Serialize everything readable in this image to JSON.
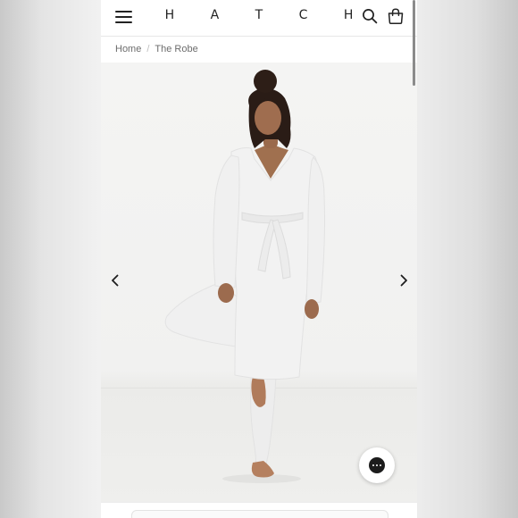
{
  "header": {
    "menu_icon": "hamburger-menu-icon",
    "logo": "H A T C H",
    "search_icon": "search-icon",
    "bag_icon": "shopping-bag-icon"
  },
  "breadcrumb": {
    "items": [
      "Home",
      "The Robe"
    ],
    "separator": "/"
  },
  "gallery": {
    "prev_icon": "chevron-left-icon",
    "next_icon": "chevron-right-icon",
    "image_subject": "model-in-white-robe-photo"
  },
  "chat": {
    "icon": "chat-bubble-icon"
  },
  "colors": {
    "page_background": "#ededed",
    "header_background": "#ffffff",
    "text_primary": "#222222",
    "breadcrumb_text": "#6d6d6d",
    "photo_background": "#f2f2f1",
    "chat_icon": "#1c1c1c"
  }
}
